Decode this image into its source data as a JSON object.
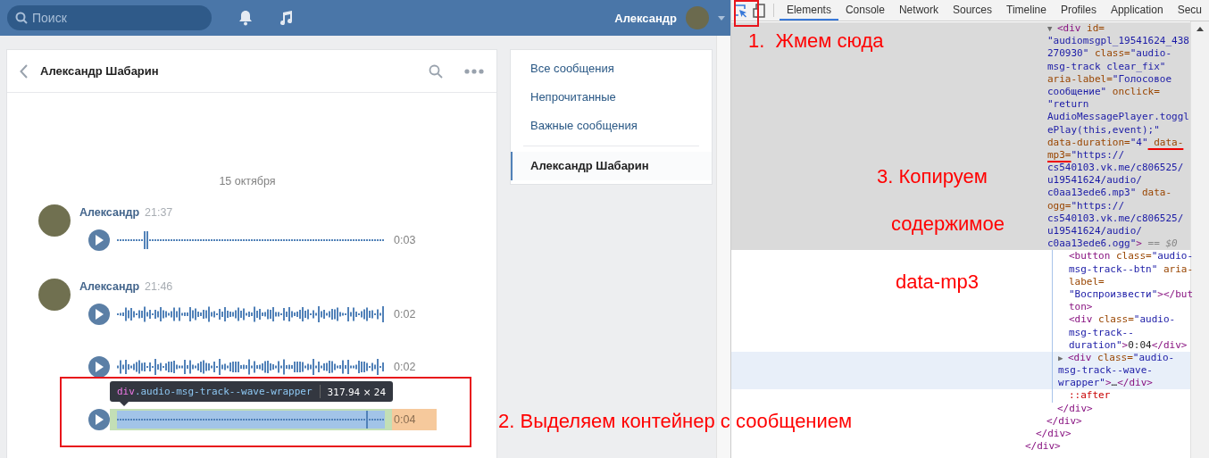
{
  "vk": {
    "header": {
      "search": {
        "placeholder": "Поиск"
      },
      "user_name": "Александр"
    },
    "dialog": {
      "title": "Александр Шабарин",
      "date": "15 октября",
      "messages": [
        {
          "author": "Александр",
          "time": "21:37",
          "audios": [
            {
              "duration": "0:03",
              "highlighted": false
            }
          ]
        },
        {
          "author": "Александр",
          "time": "21:46",
          "audios": [
            {
              "duration": "0:02",
              "highlighted": false
            },
            {
              "duration": "0:02",
              "highlighted": false
            },
            {
              "duration": "0:04",
              "highlighted": true
            }
          ]
        }
      ]
    },
    "inspect_tooltip": {
      "selector_tag": "div",
      "selector_class": ".audio-msg-track--wave-wrapper",
      "size": "317.94 × 24"
    },
    "menu": [
      {
        "label": "Все сообщения",
        "selected": false
      },
      {
        "label": "Непрочитанные",
        "selected": false
      },
      {
        "label": "Важные сообщения",
        "selected": false
      },
      {
        "label": "Александр Шабарин",
        "selected": true
      }
    ]
  },
  "devtools": {
    "inspect_active": true,
    "tabs": [
      {
        "label": "Elements",
        "selected": true
      },
      {
        "label": "Console",
        "selected": false
      },
      {
        "label": "Network",
        "selected": false
      },
      {
        "label": "Sources",
        "selected": false
      },
      {
        "label": "Timeline",
        "selected": false
      },
      {
        "label": "Profiles",
        "selected": false
      },
      {
        "label": "Application",
        "selected": false
      },
      {
        "label": "Secu",
        "selected": false
      }
    ],
    "tree": [
      {
        "selected": false,
        "hovered": false,
        "closing": [
          {
            "t": "</div>",
            "kind": "tag"
          }
        ],
        "children": [
          {
            "selected": false,
            "hovered": false,
            "closing": [
              {
                "t": "</div>",
                "kind": "tag"
              }
            ],
            "children": [
              {
                "selected": false,
                "hovered": false,
                "closing": [
                  {
                    "t": "</div>",
                    "kind": "tag"
                  }
                ],
                "children": [
                  {
                    "selected": true,
                    "hovered": false,
                    "toggle": "▼",
                    "lines": [
                      [
                        {
                          "t": "<div",
                          "kind": "tag"
                        },
                        {
                          "t": " id=",
                          "kind": "attr"
                        }
                      ],
                      [
                        {
                          "t": "\"audiomsgpl_19541624_438",
                          "kind": "value"
                        }
                      ],
                      [
                        {
                          "t": "270930\"",
                          "kind": "value"
                        },
                        {
                          "t": " class=",
                          "kind": "attr"
                        },
                        {
                          "t": "\"audio-",
                          "kind": "value"
                        }
                      ],
                      [
                        {
                          "t": "msg-track clear_fix\"",
                          "kind": "value"
                        }
                      ],
                      [
                        {
                          "t": "aria-label=",
                          "kind": "attr"
                        },
                        {
                          "t": "\"Голосовое",
                          "kind": "value"
                        }
                      ],
                      [
                        {
                          "t": "сообщение\"",
                          "kind": "value"
                        },
                        {
                          "t": " onclick=",
                          "kind": "attr"
                        }
                      ],
                      [
                        {
                          "t": "\"return",
                          "kind": "value"
                        }
                      ],
                      [
                        {
                          "t": "AudioMessagePlayer.toggl",
                          "kind": "value"
                        }
                      ],
                      [
                        {
                          "t": "ePlay(this,event);\"",
                          "kind": "value"
                        }
                      ],
                      [
                        {
                          "t": "data-duration=",
                          "kind": "attr"
                        },
                        {
                          "t": "\"4\"",
                          "kind": "value"
                        },
                        {
                          "t": " data-",
                          "kind": "attr_marked"
                        }
                      ],
                      [
                        {
                          "t": "mp3=",
                          "kind": "attr_marked"
                        },
                        {
                          "t": "\"https://",
                          "kind": "value"
                        }
                      ],
                      [
                        {
                          "t": "cs540103.vk.me/c806525/",
                          "kind": "value"
                        }
                      ],
                      [
                        {
                          "t": "u19541624/audio/",
                          "kind": "value"
                        }
                      ],
                      [
                        {
                          "t": "c0aa13ede6.mp3\"",
                          "kind": "value"
                        },
                        {
                          "t": " data-",
                          "kind": "attr"
                        }
                      ],
                      [
                        {
                          "t": "ogg=",
                          "kind": "attr"
                        },
                        {
                          "t": "\"https://",
                          "kind": "value"
                        }
                      ],
                      [
                        {
                          "t": "cs540103.vk.me/c806525/",
                          "kind": "value"
                        }
                      ],
                      [
                        {
                          "t": "u19541624/audio/",
                          "kind": "value"
                        }
                      ],
                      [
                        {
                          "t": "c0aa13ede6.ogg\"",
                          "kind": "value"
                        },
                        {
                          "t": ">",
                          "kind": "tag"
                        },
                        {
                          "t": " == $0",
                          "kind": "dim"
                        }
                      ]
                    ],
                    "children": [
                      {
                        "selected": false,
                        "hovered": false,
                        "lines": [
                          [
                            {
                              "t": "<button",
                              "kind": "tag"
                            },
                            {
                              "t": " class=",
                              "kind": "attr"
                            },
                            {
                              "t": "\"audio-",
                              "kind": "value"
                            }
                          ],
                          [
                            {
                              "t": "msg-track--btn\"",
                              "kind": "value"
                            },
                            {
                              "t": " aria-",
                              "kind": "attr"
                            }
                          ],
                          [
                            {
                              "t": "label=",
                              "kind": "attr"
                            }
                          ],
                          [
                            {
                              "t": "\"Воспроизвести\"",
                              "kind": "value"
                            },
                            {
                              "t": "></but",
                              "kind": "tag"
                            }
                          ],
                          [
                            {
                              "t": "ton>",
                              "kind": "tag"
                            }
                          ]
                        ]
                      },
                      {
                        "selected": false,
                        "hovered": false,
                        "lines": [
                          [
                            {
                              "t": "<div",
                              "kind": "tag"
                            },
                            {
                              "t": " class=",
                              "kind": "attr"
                            },
                            {
                              "t": "\"audio-",
                              "kind": "value"
                            }
                          ],
                          [
                            {
                              "t": "msg-track--",
                              "kind": "value"
                            }
                          ],
                          [
                            {
                              "t": "duration\"",
                              "kind": "value"
                            },
                            {
                              "t": ">",
                              "kind": "tag"
                            },
                            {
                              "t": "0:04",
                              "kind": "text"
                            },
                            {
                              "t": "</div>",
                              "kind": "tag"
                            }
                          ]
                        ]
                      },
                      {
                        "selected": false,
                        "hovered": true,
                        "toggle": "▶",
                        "lines": [
                          [
                            {
                              "t": "<div",
                              "kind": "tag"
                            },
                            {
                              "t": " class=",
                              "kind": "attr"
                            },
                            {
                              "t": "\"audio-",
                              "kind": "value"
                            }
                          ],
                          [
                            {
                              "t": "msg-track--wave-",
                              "kind": "value"
                            }
                          ],
                          [
                            {
                              "t": "wrapper\"",
                              "kind": "value"
                            },
                            {
                              "t": ">",
                              "kind": "tag"
                            },
                            {
                              "t": "…",
                              "kind": "text"
                            },
                            {
                              "t": "</div>",
                              "kind": "tag"
                            }
                          ]
                        ]
                      },
                      {
                        "selected": false,
                        "hovered": false,
                        "lines": [
                          [
                            {
                              "t": "::after",
                              "kind": "pseudo"
                            }
                          ]
                        ]
                      }
                    ],
                    "closing": [
                      {
                        "t": "</div>",
                        "kind": "tag"
                      }
                    ]
                  }
                ]
              }
            ]
          }
        ]
      }
    ]
  },
  "annotations": [
    {
      "text": "1.  Жмем сюда"
    },
    {
      "text": "3. Копируем"
    },
    {
      "text": "содержимое"
    },
    {
      "text": "data-mp3"
    },
    {
      "text": "2. Выделяем контейнер с сообщением"
    }
  ]
}
